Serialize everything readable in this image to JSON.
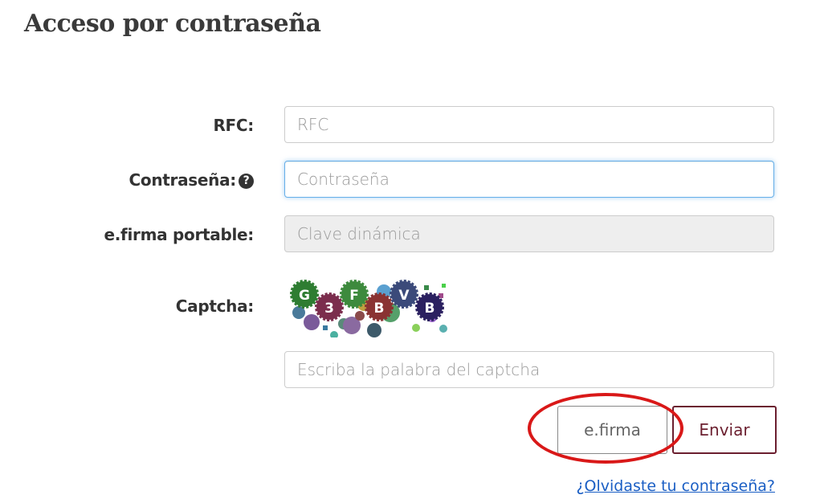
{
  "page": {
    "title": "Acceso por contraseña"
  },
  "form": {
    "rfc": {
      "label": "RFC:",
      "placeholder": "RFC",
      "value": ""
    },
    "password": {
      "label": "Contraseña:",
      "placeholder": "Contraseña",
      "value": "",
      "help_icon": "question-circle-icon"
    },
    "efirma_portable": {
      "label": "e.firma portable:",
      "placeholder": "Clave dinámica",
      "value": "",
      "disabled": true
    },
    "captcha": {
      "label": "Captcha:",
      "text": "G3FBVB",
      "placeholder": "Escriba la palabra del captcha",
      "value": ""
    }
  },
  "buttons": {
    "efirma": "e.firma",
    "enviar": "Enviar"
  },
  "links": {
    "forgot_password": "¿Olvidaste tu contraseña?"
  },
  "colors": {
    "accent": "#6b1f2f",
    "focus": "#66afe9",
    "annotation": "#d91818",
    "link": "#1a5ec4"
  }
}
